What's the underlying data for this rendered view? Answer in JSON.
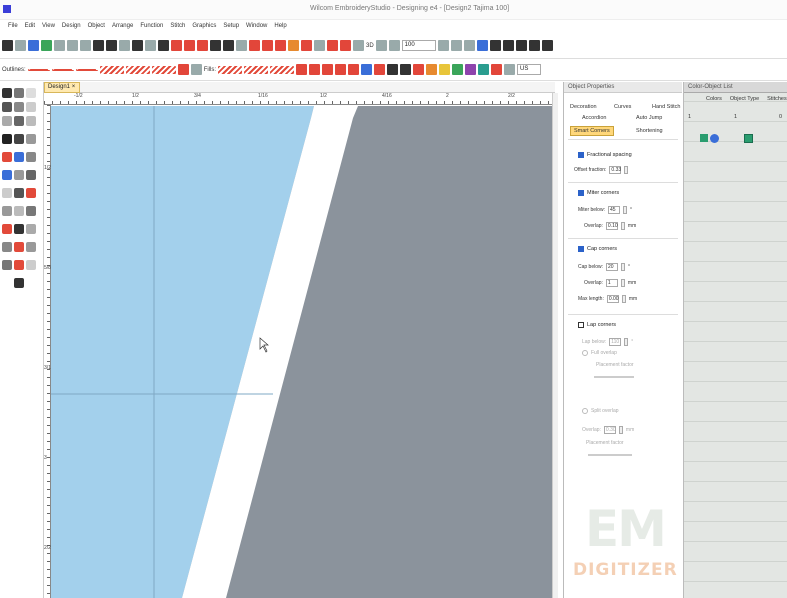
{
  "window": {
    "title": "Wilcom EmbroideryStudio - Designing e4 - [Design2      Tajima 100]"
  },
  "menu": [
    "File",
    "Edit",
    "View",
    "Design",
    "Object",
    "Arrange",
    "Function",
    "Stitch",
    "Graphics",
    "Setup",
    "Window",
    "Help"
  ],
  "toolbar1": {
    "zoom_value": "100",
    "three_d": "3D"
  },
  "toolbar2": {
    "outlines_label": "Outlines:",
    "fills_label": "Fills:",
    "unit_combo": "US"
  },
  "design_tab": {
    "label": "Design1",
    "close": "×"
  },
  "ruler": {
    "top_labels": [
      "-1/2",
      "1/2",
      "3/4",
      "1/16",
      "1/2",
      "4/16",
      "2",
      "2/2"
    ],
    "left_labels": [
      "1/2",
      "5/8",
      "3/16",
      "3",
      "2/2"
    ]
  },
  "object_properties": {
    "title": "Object Properties",
    "tabs": [
      "Decoration",
      "Curves",
      "Hand Stitch",
      "Accordion",
      "Auto Jump",
      "Smart Corners",
      "Shortening"
    ],
    "fractional_spacing": {
      "label": "Fractional spacing",
      "checked": true,
      "offset_label": "Offset fraction:",
      "offset_value": "0.33"
    },
    "miter_corners": {
      "label": "Miter corners",
      "checked": true,
      "miter_below_label": "Miter below:",
      "miter_below_value": "45",
      "miter_unit": "°",
      "overlap_label": "Overlap:",
      "overlap_value": "0.10",
      "overlap_unit": "mm"
    },
    "cap_corners": {
      "label": "Cap corners",
      "checked": true,
      "cap_below_label": "Cap below:",
      "cap_below_value": "20",
      "cap_unit": "°",
      "overlap_label": "Overlap:",
      "overlap_value": "1",
      "overlap_unit": "mm",
      "max_length_label": "Max length:",
      "max_length_value": "0.00",
      "max_length_unit": "mm"
    },
    "lap_corners": {
      "label": "Lap corners",
      "checked": false,
      "lap_below_label": "Lap below:",
      "lap_below_value": "110",
      "lap_unit": "°",
      "full_overlap": "Full overlap",
      "placement_label": "Placement factor",
      "split_overlap": "Split overlap",
      "overlap_label": "Overlap:",
      "overlap_value": "0.30",
      "overlap_unit": "mm",
      "placement_label2": "Placement factor"
    }
  },
  "color_list": {
    "title": "Color-Object List",
    "columns": [
      "Colors",
      "Object Type",
      "Stitches"
    ],
    "row": {
      "left": "1",
      "mid": "1",
      "right": "0"
    }
  },
  "watermark": {
    "em": "EM",
    "digitizer": "DIGITIZER"
  },
  "colors": {
    "fill_blue": "#a3d0ec",
    "canvas_gray": "#8b939c",
    "tab_active": "#ffd77a"
  }
}
